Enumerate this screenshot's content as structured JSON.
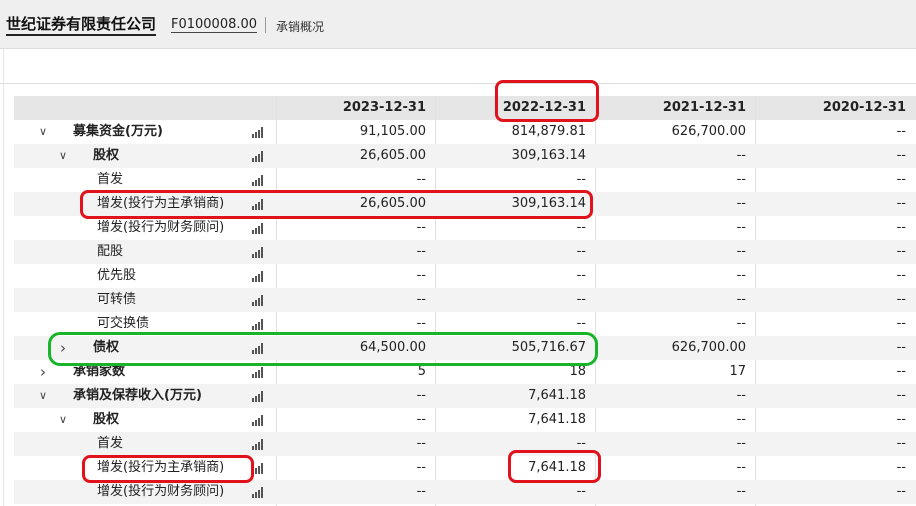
{
  "header": {
    "company": "世纪证券有限责任公司",
    "code": "F0100008.00",
    "page": "承销概况"
  },
  "table": {
    "columns": [
      "2023-12-31",
      "2022-12-31",
      "2021-12-31",
      "2020-12-31"
    ],
    "rows": [
      {
        "label": "募集资金(万元)",
        "level": 0,
        "expander": "expanded",
        "bold": true,
        "values": [
          "91,105.00",
          "814,879.81",
          "626,700.00",
          "--"
        ]
      },
      {
        "label": "股权",
        "level": 1,
        "expander": "expanded",
        "bold": true,
        "values": [
          "26,605.00",
          "309,163.14",
          "--",
          "--"
        ]
      },
      {
        "label": "首发",
        "level": 2,
        "expander": "none",
        "bold": false,
        "values": [
          "--",
          "--",
          "--",
          "--"
        ]
      },
      {
        "label": "增发(投行为主承销商)",
        "level": 2,
        "expander": "none",
        "bold": false,
        "values": [
          "26,605.00",
          "309,163.14",
          "--",
          "--"
        ]
      },
      {
        "label": "增发(投行为财务顾问)",
        "level": 2,
        "expander": "none",
        "bold": false,
        "values": [
          "--",
          "--",
          "--",
          "--"
        ]
      },
      {
        "label": "配股",
        "level": 2,
        "expander": "none",
        "bold": false,
        "values": [
          "--",
          "--",
          "--",
          "--"
        ]
      },
      {
        "label": "优先股",
        "level": 2,
        "expander": "none",
        "bold": false,
        "values": [
          "--",
          "--",
          "--",
          "--"
        ]
      },
      {
        "label": "可转债",
        "level": 2,
        "expander": "none",
        "bold": false,
        "values": [
          "--",
          "--",
          "--",
          "--"
        ]
      },
      {
        "label": "可交换债",
        "level": 2,
        "expander": "none",
        "bold": false,
        "values": [
          "--",
          "--",
          "--",
          "--"
        ]
      },
      {
        "label": "债权",
        "level": 1,
        "expander": "collapsed",
        "bold": true,
        "values": [
          "64,500.00",
          "505,716.67",
          "626,700.00",
          "--"
        ]
      },
      {
        "label": "承销家数",
        "level": 0,
        "expander": "collapsed",
        "bold": true,
        "values": [
          "5",
          "18",
          "17",
          "--"
        ]
      },
      {
        "label": "承销及保荐收入(万元)",
        "level": 0,
        "expander": "expanded",
        "bold": true,
        "values": [
          "--",
          "7,641.18",
          "--",
          "--"
        ]
      },
      {
        "label": "股权",
        "level": 1,
        "expander": "expanded",
        "bold": true,
        "values": [
          "--",
          "7,641.18",
          "--",
          "--"
        ]
      },
      {
        "label": "首发",
        "level": 2,
        "expander": "none",
        "bold": false,
        "values": [
          "--",
          "--",
          "--",
          "--"
        ]
      },
      {
        "label": "增发(投行为主承销商)",
        "level": 2,
        "expander": "none",
        "bold": false,
        "values": [
          "--",
          "7,641.18",
          "--",
          "--"
        ]
      },
      {
        "label": "增发(投行为财务顾问)",
        "level": 2,
        "expander": "none",
        "bold": false,
        "values": [
          "--",
          "--",
          "--",
          "--"
        ]
      }
    ]
  },
  "icons": {
    "expanded": "chevron-down-icon",
    "collapsed": "chevron-right-icon",
    "chart": "bar-chart-icon"
  },
  "colors": {
    "highlight_red": "#e0121b",
    "highlight_green": "#18b52b",
    "header_bg": "#e6e6e6",
    "alt_row_bg": "#f3f3f3"
  }
}
